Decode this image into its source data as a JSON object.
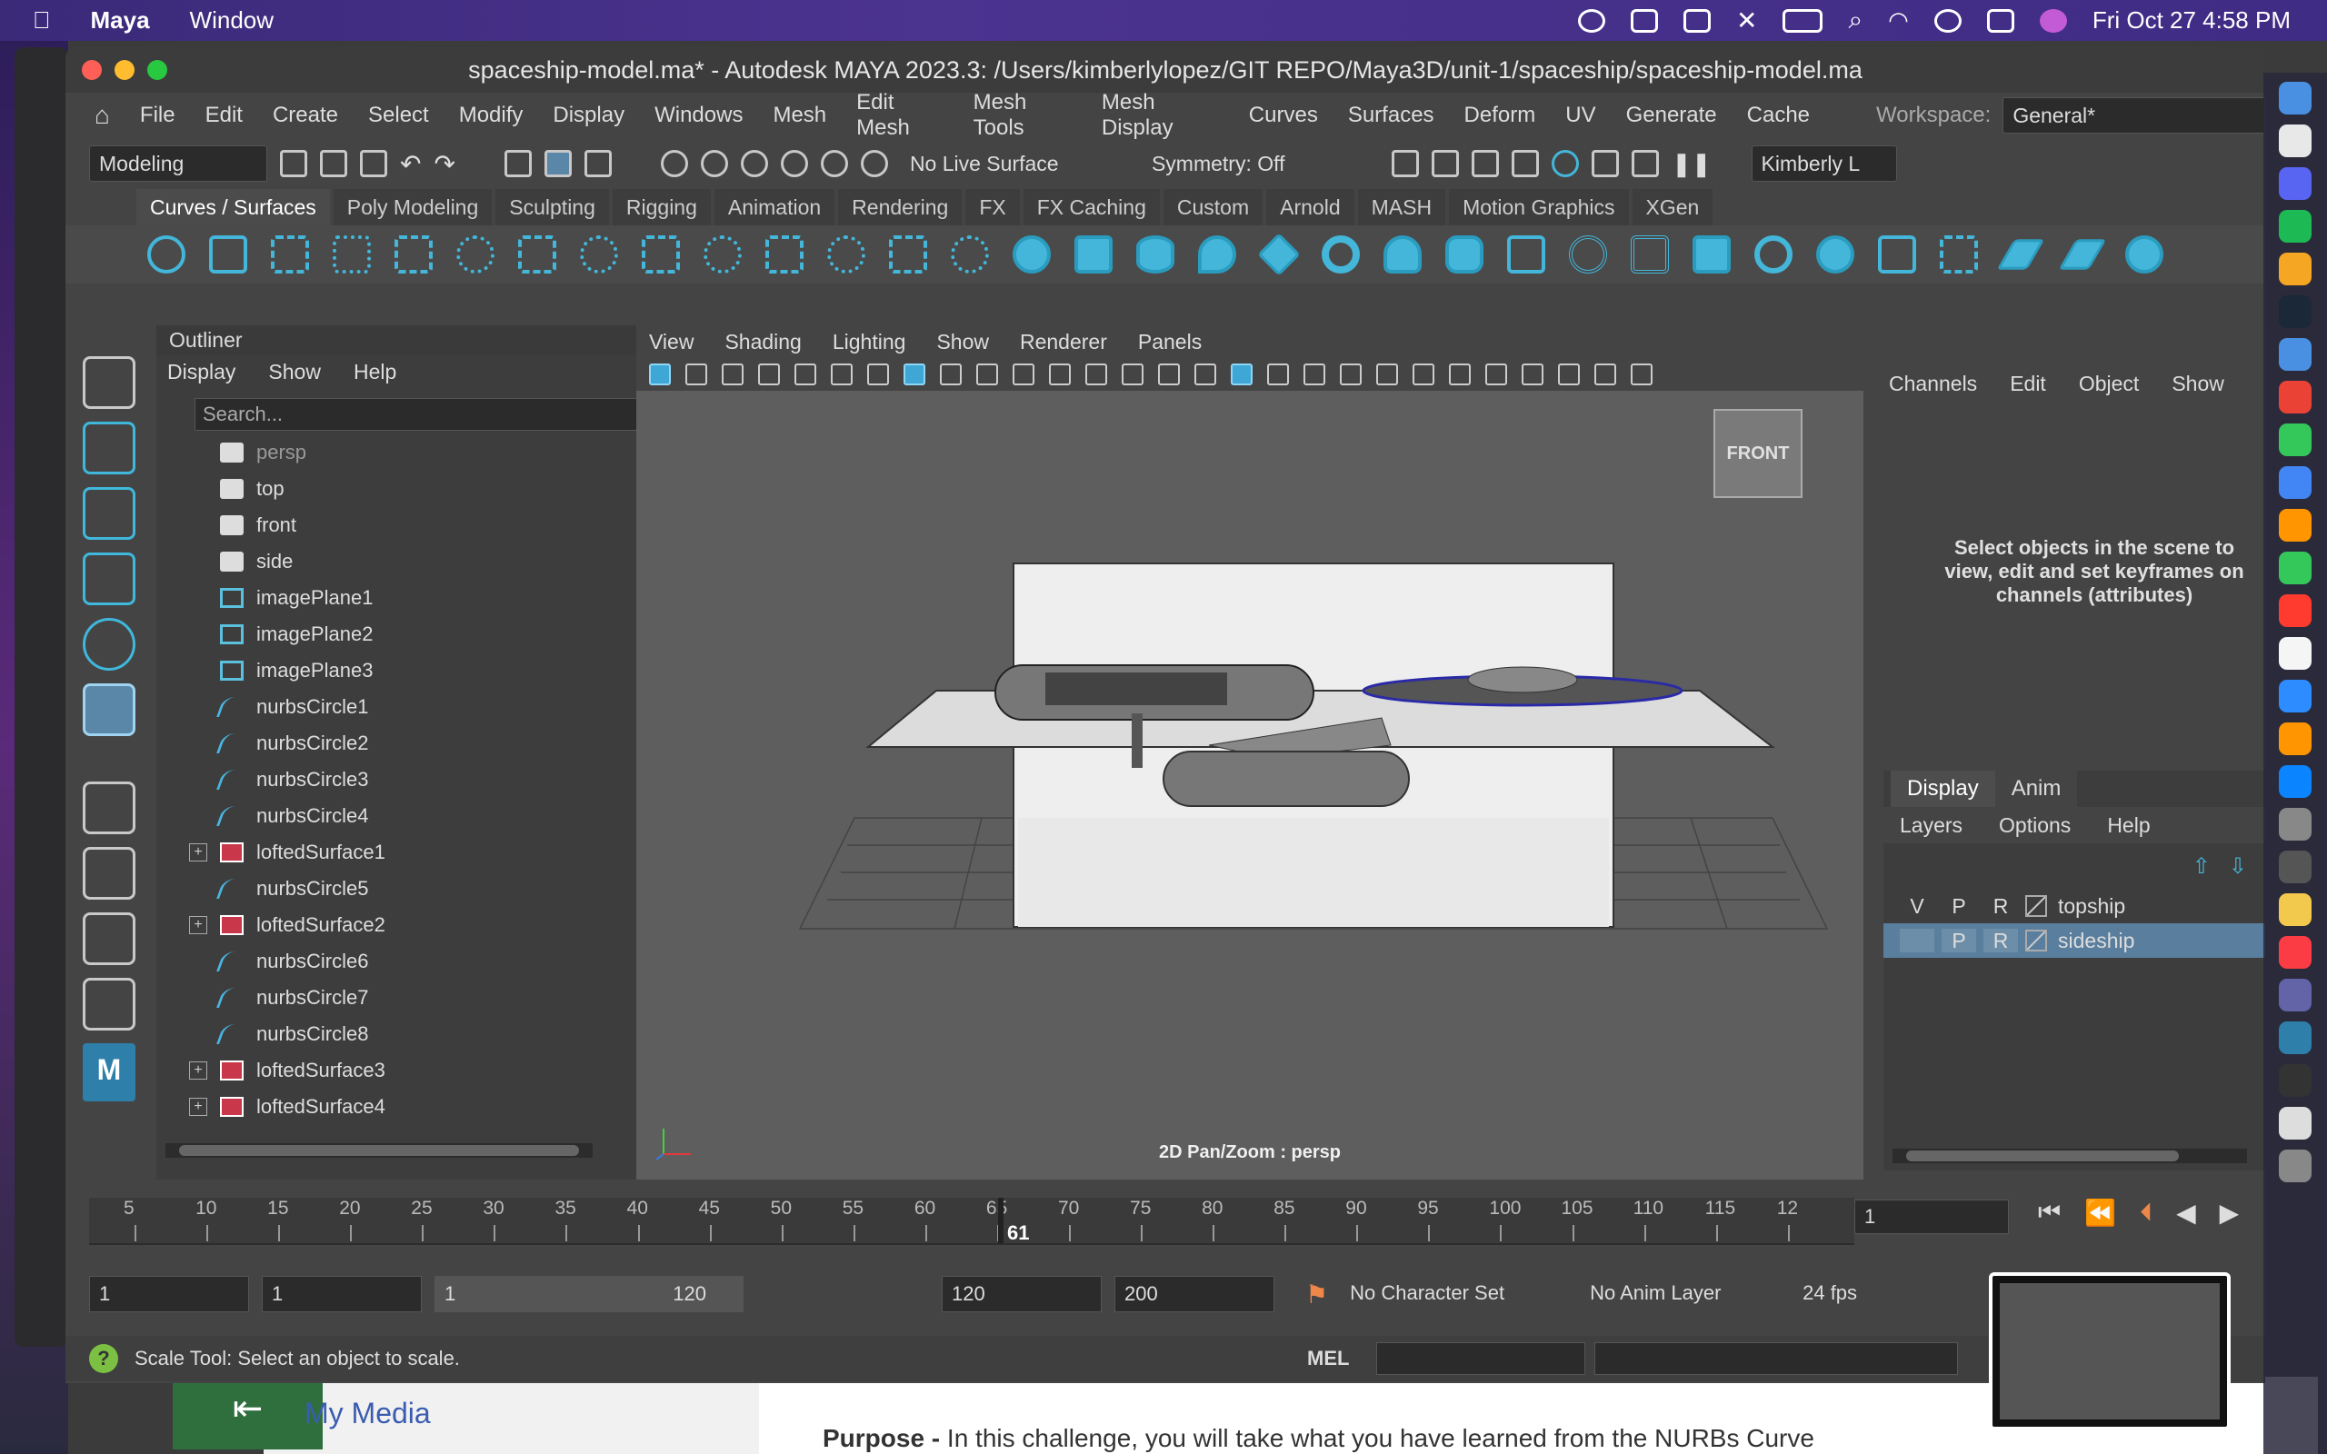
{
  "macmenu": {
    "app": "Maya",
    "window": "Window",
    "datetime": "Fri Oct 27  4:58 PM"
  },
  "title": "spaceship-model.ma* - Autodesk MAYA 2023.3: /Users/kimberlylopez/GIT REPO/Maya3D/unit-1/spaceship/spaceship-model.ma",
  "menus": [
    "File",
    "Edit",
    "Create",
    "Select",
    "Modify",
    "Display",
    "Windows",
    "Mesh",
    "Edit Mesh",
    "Mesh Tools",
    "Mesh Display",
    "Curves",
    "Surfaces",
    "Deform",
    "UV",
    "Generate",
    "Cache"
  ],
  "workspace": {
    "label": "Workspace:",
    "value": "General*"
  },
  "toolbar": {
    "mode": "Modeling",
    "live_surface": "No Live Surface",
    "symmetry": "Symmetry: Off",
    "user": "Kimberly L"
  },
  "shelf_tabs": [
    "Curves / Surfaces",
    "Poly Modeling",
    "Sculpting",
    "Rigging",
    "Animation",
    "Rendering",
    "FX",
    "FX Caching",
    "Custom",
    "Arnold",
    "MASH",
    "Motion Graphics",
    "XGen"
  ],
  "outliner": {
    "title": "Outliner",
    "menu": [
      "Display",
      "Show",
      "Help"
    ],
    "search_placeholder": "Search...",
    "items": [
      {
        "label": "persp",
        "icon": "camera-icon",
        "expand": false,
        "dim": true
      },
      {
        "label": "top",
        "icon": "camera-icon",
        "expand": false
      },
      {
        "label": "front",
        "icon": "camera-icon",
        "expand": false
      },
      {
        "label": "side",
        "icon": "camera-icon",
        "expand": false
      },
      {
        "label": "imagePlane1",
        "icon": "image-plane-icon",
        "expand": false
      },
      {
        "label": "imagePlane2",
        "icon": "image-plane-icon",
        "expand": false
      },
      {
        "label": "imagePlane3",
        "icon": "image-plane-icon",
        "expand": false
      },
      {
        "label": "nurbsCircle1",
        "icon": "nurbs-curve-icon",
        "expand": false
      },
      {
        "label": "nurbsCircle2",
        "icon": "nurbs-curve-icon",
        "expand": false
      },
      {
        "label": "nurbsCircle3",
        "icon": "nurbs-curve-icon",
        "expand": false
      },
      {
        "label": "nurbsCircle4",
        "icon": "nurbs-curve-icon",
        "expand": false
      },
      {
        "label": "loftedSurface1",
        "icon": "nurbs-surface-icon",
        "expand": true
      },
      {
        "label": "nurbsCircle5",
        "icon": "nurbs-curve-icon",
        "expand": false
      },
      {
        "label": "loftedSurface2",
        "icon": "nurbs-surface-icon",
        "expand": true
      },
      {
        "label": "nurbsCircle6",
        "icon": "nurbs-curve-icon",
        "expand": false
      },
      {
        "label": "nurbsCircle7",
        "icon": "nurbs-curve-icon",
        "expand": false
      },
      {
        "label": "nurbsCircle8",
        "icon": "nurbs-curve-icon",
        "expand": false
      },
      {
        "label": "loftedSurface3",
        "icon": "nurbs-surface-icon",
        "expand": true
      },
      {
        "label": "loftedSurface4",
        "icon": "nurbs-surface-icon",
        "expand": true
      }
    ]
  },
  "viewport": {
    "menu": [
      "View",
      "Shading",
      "Lighting",
      "Show",
      "Renderer",
      "Panels"
    ],
    "view_cube": "FRONT",
    "status_label": "2D Pan/Zoom : persp"
  },
  "channelbox": {
    "menu": [
      "Channels",
      "Edit",
      "Object",
      "Show"
    ],
    "message": "Select objects in the scene to view, edit and set keyframes on channels (attributes)"
  },
  "layers": {
    "tabs": [
      "Display",
      "Anim"
    ],
    "menu": [
      "Layers",
      "Options",
      "Help"
    ],
    "rows": [
      {
        "v": "V",
        "p": "P",
        "r": "R",
        "name": "topship",
        "selected": false
      },
      {
        "v": "",
        "p": "P",
        "r": "R",
        "name": "sideship",
        "selected": true
      }
    ]
  },
  "timeline": {
    "ticks": [
      "5",
      "10",
      "15",
      "20",
      "25",
      "30",
      "35",
      "40",
      "45",
      "50",
      "55",
      "60",
      "65",
      "70",
      "75",
      "80",
      "85",
      "90",
      "95",
      "100",
      "105",
      "110",
      "115",
      "12"
    ],
    "current_frame_label": "61",
    "current_frame_field": "1"
  },
  "range": {
    "start": "1",
    "playback_start": "1",
    "slider_start": "1",
    "slider_end": "120",
    "playback_end": "120",
    "end": "200",
    "character_set": "No Character Set",
    "anim_layer": "No Anim Layer",
    "fps": "24 fps"
  },
  "status": {
    "help": "Scale Tool: Select an object to scale.",
    "mel": "MEL"
  },
  "browser": {
    "my_media": "My Media",
    "purpose_label": "Purpose -",
    "purpose_text": " In this challenge, you will take what you have learned from the NURBs Curve"
  },
  "colors": {
    "accent": "#43b6d9",
    "selection": "#5a7f9e",
    "loft": "#c8384a"
  }
}
